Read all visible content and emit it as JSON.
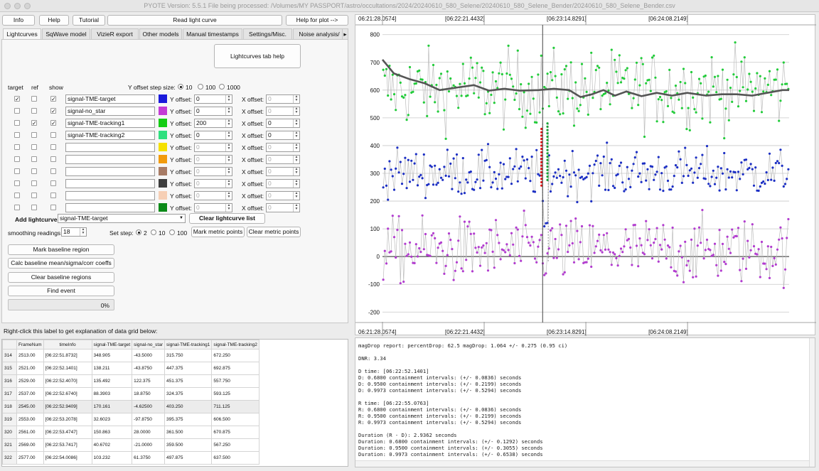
{
  "title": "PYOTE Version: 5.5.1  File being processed: /Volumes/MY PASSPORT/astro/occultations/2024/20240610_580_Selene/20240610_580_Selene_Bender/20240610_580_Selene_Bender.csv",
  "toolbar": {
    "info": "Info",
    "help": "Help",
    "tutorial": "Tutorial",
    "read_lc": "Read light curve",
    "help_plot": "Help for plot -->"
  },
  "tabs": [
    "Lightcurves",
    "SqWave model",
    "VizieR export",
    "Other models",
    "Manual timestamps",
    "Settings/Misc.",
    "Noise analysis/"
  ],
  "tab_help": "Lightcurves tab help",
  "headers": {
    "target": "target",
    "ref": "ref",
    "show": "show"
  },
  "yoffset_step_label": "Y offset step size:",
  "yoffset_steps": [
    "10",
    "100",
    "1000"
  ],
  "y_offset_label": "Y offset:",
  "x_offset_label": "X offset:",
  "curves": [
    {
      "name": "signal-TME-target",
      "target": true,
      "ref": false,
      "show": true,
      "color": "#1a1adb",
      "yoff": "0",
      "xoff": "0",
      "active": true
    },
    {
      "name": "signal-no_star",
      "target": false,
      "ref": false,
      "show": true,
      "color": "#c43bd6",
      "yoff": "0",
      "xoff": "0",
      "active": true
    },
    {
      "name": "signal-TME-tracking1",
      "target": false,
      "ref": true,
      "show": true,
      "color": "#14cc14",
      "yoff": "200",
      "xoff": "0",
      "active": true
    },
    {
      "name": "signal-TME-tracking2",
      "target": false,
      "ref": false,
      "show": false,
      "color": "#2fe07f",
      "yoff": "0",
      "xoff": "0",
      "active": true
    },
    {
      "name": "",
      "target": false,
      "ref": false,
      "show": false,
      "color": "#f5e000",
      "yoff": "0",
      "xoff": "0",
      "active": false
    },
    {
      "name": "",
      "target": false,
      "ref": false,
      "show": false,
      "color": "#f29b0c",
      "yoff": "0",
      "xoff": "0",
      "active": false
    },
    {
      "name": "",
      "target": false,
      "ref": false,
      "show": false,
      "color": "#a87c66",
      "yoff": "0",
      "xoff": "0",
      "active": false
    },
    {
      "name": "",
      "target": false,
      "ref": false,
      "show": false,
      "color": "#3e3e3e",
      "yoff": "0",
      "xoff": "0",
      "active": false
    },
    {
      "name": "",
      "target": false,
      "ref": false,
      "show": false,
      "color": "#f6cfb5",
      "yoff": "0",
      "xoff": "0",
      "active": false
    },
    {
      "name": "",
      "target": false,
      "ref": false,
      "show": false,
      "color": "#0b8a18",
      "yoff": "0",
      "xoff": "0",
      "active": false
    }
  ],
  "add_lc_label": "Add lightcurve",
  "add_lc_value": "signal-TME-target",
  "clear_lc_list": "Clear lightcurve list",
  "smoothing_label": "smoothing readings",
  "smoothing_value": "18",
  "set_step_label": "Set step:",
  "set_steps": [
    "2",
    "10",
    "100"
  ],
  "mark_metric": "Mark metric points",
  "clear_metric": "Clear metric points",
  "mark_baseline": "Mark baseline region",
  "calc_baseline": "Calc baseline mean/sigma/corr coeffs",
  "clear_baseline": "Clear baseline regions",
  "find_event": "Find event",
  "progress_text": "0%",
  "progress_value": 0,
  "grid_label": "Right-click this label to get explanation of data grid below:",
  "grid": {
    "columns": [
      "FrameNum",
      "timeInfo",
      "signal-TME-target",
      "signal-no_star",
      "signal-TME-tracking1",
      "signal-TME-tracking2"
    ],
    "rows": [
      {
        "idx": "314",
        "cells": [
          "2513.00",
          "[06:22:51.8732]",
          "348.905",
          "-43.5000",
          "315.750",
          "672.250"
        ]
      },
      {
        "idx": "315",
        "cells": [
          "2521.00",
          "[06:22:52.1401]",
          "138.211",
          "-43.8750",
          "447.375",
          "692.875"
        ]
      },
      {
        "idx": "316",
        "cells": [
          "2529.00",
          "[06:22:52.4070]",
          "135.492",
          "122.375",
          "451.375",
          "557.750"
        ]
      },
      {
        "idx": "317",
        "cells": [
          "2537.00",
          "[06:22:52.6740]",
          "88.3903",
          "18.8750",
          "324.375",
          "593.125"
        ]
      },
      {
        "idx": "318",
        "cells": [
          "2545.00",
          "[06:22:52.9409]",
          "170.161",
          "-4.62500",
          "403.250",
          "711.125"
        ]
      },
      {
        "idx": "319",
        "cells": [
          "2553.00",
          "[06:22:53.2078]",
          "32.6023",
          "-97.8750",
          "395.375",
          "606.500"
        ]
      },
      {
        "idx": "320",
        "cells": [
          "2561.00",
          "[06:22:53.4747]",
          "150.863",
          "28.0000",
          "361.500",
          "670.875"
        ]
      },
      {
        "idx": "321",
        "cells": [
          "2569.00",
          "[06:22:53.7417]",
          "40.6702",
          "-21.0000",
          "359.500",
          "567.250"
        ]
      },
      {
        "idx": "322",
        "cells": [
          "2577.00",
          "[06:22:54.0086]",
          "103.232",
          "61.3750",
          "497.875",
          "637.500"
        ]
      }
    ]
  },
  "report_lines": [
    "magDrop report: percentDrop: 62.5 magDrop: 1.064 +/- 0.275 (0.95 ci)",
    "",
    "DNR: 3.34",
    "",
    "D time: [06:22:52.1401]",
    "D: 0.6800 containment intervals: (+/- 0.0836) seconds",
    "D: 0.9500 containment intervals: (+/- 0.2199) seconds",
    "D: 0.9973 containment intervals: (+/- 0.5294) seconds",
    "",
    "R time: [06:22:55.0763]",
    "R: 0.6800 containment intervals: (+/- 0.0836) seconds",
    "R: 0.9500 containment intervals: (+/- 0.2199) seconds",
    "R: 0.9973 containment intervals: (+/- 0.5294) seconds",
    "",
    "Duration (R - D): 2.9362 seconds",
    "Duration: 0.6800 containment intervals: (+/- 0.1292) seconds",
    "Duration: 0.9500 containment intervals: (+/- 0.3055) seconds",
    "Duration: 0.9973 containment intervals: (+/- 0.6538) seconds"
  ],
  "chart_data": {
    "type": "scatter",
    "x_tick_labels": [
      "06:21:28.0574]",
      "[06:22:21.4432]",
      "[06:23:14.8291]",
      "[06:24:08.2149]"
    ],
    "x_range_s": [
      0,
      213.5
    ],
    "x_ticks_s": [
      0,
      53.386,
      106.772,
      160.158
    ],
    "ylim": [
      -230,
      830
    ],
    "y_ticks": [
      -200,
      -100,
      0,
      100,
      200,
      300,
      400,
      500,
      600,
      700,
      800
    ],
    "event_marker_s": 84.08,
    "event_D_s": 84.08,
    "event_R_s": 87.02,
    "sample_interval_s": 0.2669,
    "series": [
      {
        "name": "signal-TME-tracking1",
        "color": "#22cc3a",
        "mean": 604,
        "noise": 68
      },
      {
        "name": "signal-TME-target",
        "color": "#1c2fc4",
        "mean": 302,
        "noise": 42,
        "event_mean": 112
      },
      {
        "name": "signal-no_star",
        "color": "#b23ccf",
        "mean": 22,
        "noise": 58
      }
    ],
    "smoothed": [
      [
        0,
        710
      ],
      [
        6,
        660
      ],
      [
        14,
        640
      ],
      [
        22,
        625
      ],
      [
        30,
        600
      ],
      [
        40,
        610
      ],
      [
        48,
        618
      ],
      [
        56,
        598
      ],
      [
        64,
        605
      ],
      [
        72,
        598
      ],
      [
        82,
        600
      ],
      [
        90,
        605
      ],
      [
        98,
        600
      ],
      [
        104,
        575
      ],
      [
        110,
        585
      ],
      [
        116,
        600
      ],
      [
        122,
        580
      ],
      [
        128,
        595
      ],
      [
        136,
        578
      ],
      [
        144,
        590
      ],
      [
        152,
        580
      ],
      [
        160,
        590
      ],
      [
        170,
        580
      ],
      [
        178,
        585
      ],
      [
        186,
        585
      ],
      [
        194,
        580
      ],
      [
        202,
        590
      ],
      [
        210,
        600
      ],
      [
        213.5,
        600
      ]
    ]
  }
}
